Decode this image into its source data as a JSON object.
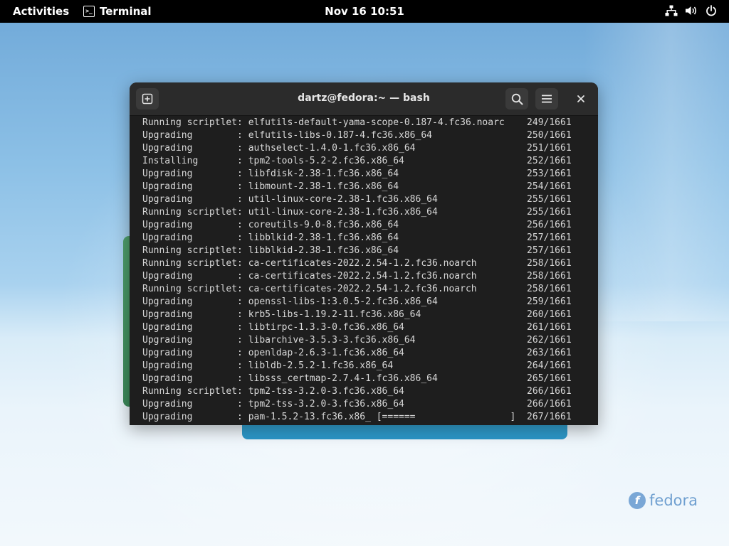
{
  "topbar": {
    "activities": "Activities",
    "app_name": "Terminal",
    "app_icon_glyph": ">_",
    "clock": "Nov 16  10:51",
    "tray_icons": [
      "network-icon",
      "volume-icon",
      "power-icon"
    ]
  },
  "terminal": {
    "title": "dartz@fedora:~ — bash",
    "lines": [
      "Running scriptlet: elfutils-default-yama-scope-0.187-4.fc36.noarc    249/1661",
      "Upgrading        : elfutils-libs-0.187-4.fc36.x86_64                 250/1661",
      "Upgrading        : authselect-1.4.0-1.fc36.x86_64                    251/1661",
      "Installing       : tpm2-tools-5.2-2.fc36.x86_64                      252/1661",
      "Upgrading        : libfdisk-2.38-1.fc36.x86_64                       253/1661",
      "Upgrading        : libmount-2.38-1.fc36.x86_64                       254/1661",
      "Upgrading        : util-linux-core-2.38-1.fc36.x86_64                255/1661",
      "Running scriptlet: util-linux-core-2.38-1.fc36.x86_64                255/1661",
      "Upgrading        : coreutils-9.0-8.fc36.x86_64                       256/1661",
      "Upgrading        : libblkid-2.38-1.fc36.x86_64                       257/1661",
      "Running scriptlet: libblkid-2.38-1.fc36.x86_64                       257/1661",
      "Running scriptlet: ca-certificates-2022.2.54-1.2.fc36.noarch         258/1661",
      "Upgrading        : ca-certificates-2022.2.54-1.2.fc36.noarch         258/1661",
      "Running scriptlet: ca-certificates-2022.2.54-1.2.fc36.noarch         258/1661",
      "Upgrading        : openssl-libs-1:3.0.5-2.fc36.x86_64                259/1661",
      "Upgrading        : krb5-libs-1.19.2-11.fc36.x86_64                   260/1661",
      "Upgrading        : libtirpc-1.3.3-0.fc36.x86_64                      261/1661",
      "Upgrading        : libarchive-3.5.3-3.fc36.x86_64                    262/1661",
      "Upgrading        : openldap-2.6.3-1.fc36.x86_64                      263/1661",
      "Upgrading        : libldb-2.5.2-1.fc36.x86_64                        264/1661",
      "Upgrading        : libsss_certmap-2.7.4-1.fc36.x86_64                265/1661",
      "Running scriptlet: tpm2-tss-3.2.0-3.fc36.x86_64                      266/1661",
      "Upgrading        : tpm2-tss-3.2.0-3.fc36.x86_64                      266/1661",
      "Upgrading        : pam-1.5.2-13.fc36.x86_ [======                 ]  267/1661"
    ]
  },
  "desktop": {
    "logo_text": "fedora",
    "logo_mark": "f"
  },
  "colors": {
    "terminal_bg": "#1e1e1e",
    "headerbar_bg": "#2b2b2b",
    "terminal_text": "#d8d8d8",
    "topbar_bg": "#000000"
  }
}
